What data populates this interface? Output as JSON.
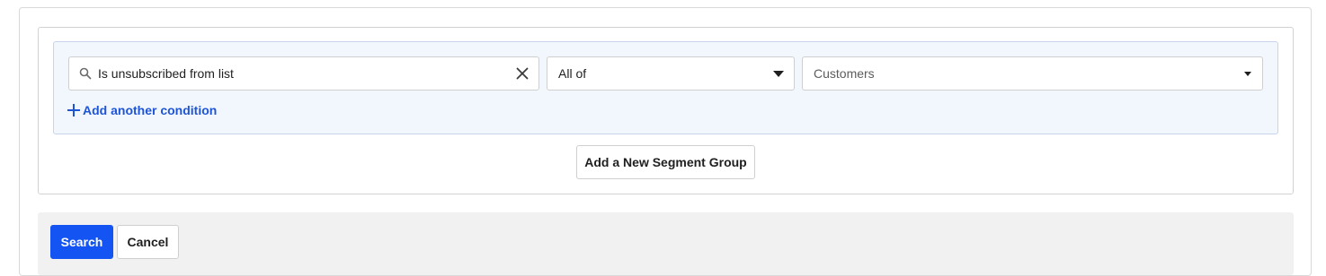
{
  "condition": {
    "input_value": "Is unsubscribed from list",
    "search_icon": "search-icon",
    "clear_icon": "close-icon"
  },
  "match_select": {
    "selected": "All of",
    "icon": "caret-down-icon"
  },
  "list_select": {
    "selected": "Customers",
    "icon": "caret-down-icon"
  },
  "add_condition": {
    "label": "Add another condition",
    "icon": "plus-icon"
  },
  "add_group": {
    "label": "Add a New Segment Group"
  },
  "footer": {
    "search_label": "Search",
    "cancel_label": "Cancel"
  },
  "colors": {
    "primary": "#1454f2",
    "link": "#1e55d6",
    "group_background": "#f2f6fd",
    "footer_background": "#f1f1f1"
  }
}
